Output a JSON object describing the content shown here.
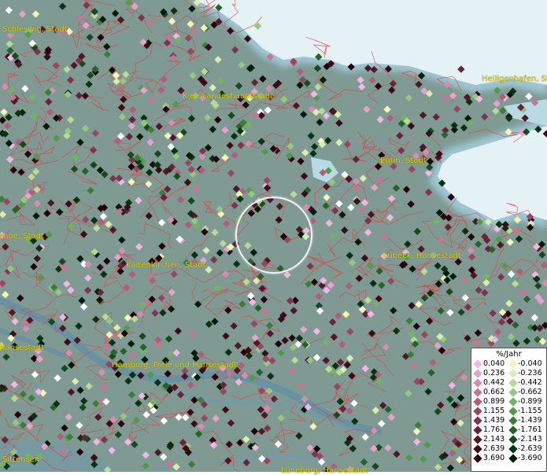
{
  "cities": [
    {
      "name": "Schleswig, Stadt"
    },
    {
      "name": "Kiel, Landeshauptstadt"
    },
    {
      "name": "Heiligenhafen, Stadt"
    },
    {
      "name": "Eutin, Stadt"
    },
    {
      "name": "Itzehoe, Stadt"
    },
    {
      "name": "Kaltenkirchen, Stadt"
    },
    {
      "name": "Lübeck, Hansestadt"
    },
    {
      "name": "Hansestadt"
    },
    {
      "name": "Hamburg, Freie und Hansestadt"
    },
    {
      "name": "Sittensen"
    },
    {
      "name": "Lüneburg, Hansestadt"
    }
  ],
  "legend": {
    "title": "%/Jahr",
    "positive": [
      {
        "label": "0.040",
        "color": "#f2b6e2"
      },
      {
        "label": "0.236",
        "color": "#e9a1cc"
      },
      {
        "label": "0.442",
        "color": "#d98cb0"
      },
      {
        "label": "0.662",
        "color": "#c77495"
      },
      {
        "label": "0.899",
        "color": "#b35d7c"
      },
      {
        "label": "1.155",
        "color": "#9a4562"
      },
      {
        "label": "1.439",
        "color": "#82324d"
      },
      {
        "label": "1.761",
        "color": "#6b2238"
      },
      {
        "label": "2.143",
        "color": "#541527"
      },
      {
        "label": "2.639",
        "color": "#3d0b18"
      },
      {
        "label": "3.690",
        "color": "#26030a"
      }
    ],
    "negative": [
      {
        "label": "-0.040",
        "color": "#f2f6b8"
      },
      {
        "label": "-0.236",
        "color": "#d8eeae"
      },
      {
        "label": "-0.442",
        "color": "#b6dc94"
      },
      {
        "label": "-0.662",
        "color": "#94c97c"
      },
      {
        "label": "-0.899",
        "color": "#72b463"
      },
      {
        "label": "-1.155",
        "color": "#529b4c"
      },
      {
        "label": "-1.439",
        "color": "#387f38"
      },
      {
        "label": "-1.761",
        "color": "#236428"
      },
      {
        "label": "-2.143",
        "color": "#134b1b"
      },
      {
        "label": "-2.639",
        "color": "#083411"
      },
      {
        "label": "-3.690",
        "color": "#021d07"
      }
    ]
  },
  "colors": {
    "land": "#7e9a93",
    "sea": "#e4f2f6",
    "water_edge": "#9ec6d2",
    "river": "#5f8fa6",
    "borders": "#d44",
    "city_label": "#e8d400",
    "focus_ring": "#f4f4f4"
  }
}
